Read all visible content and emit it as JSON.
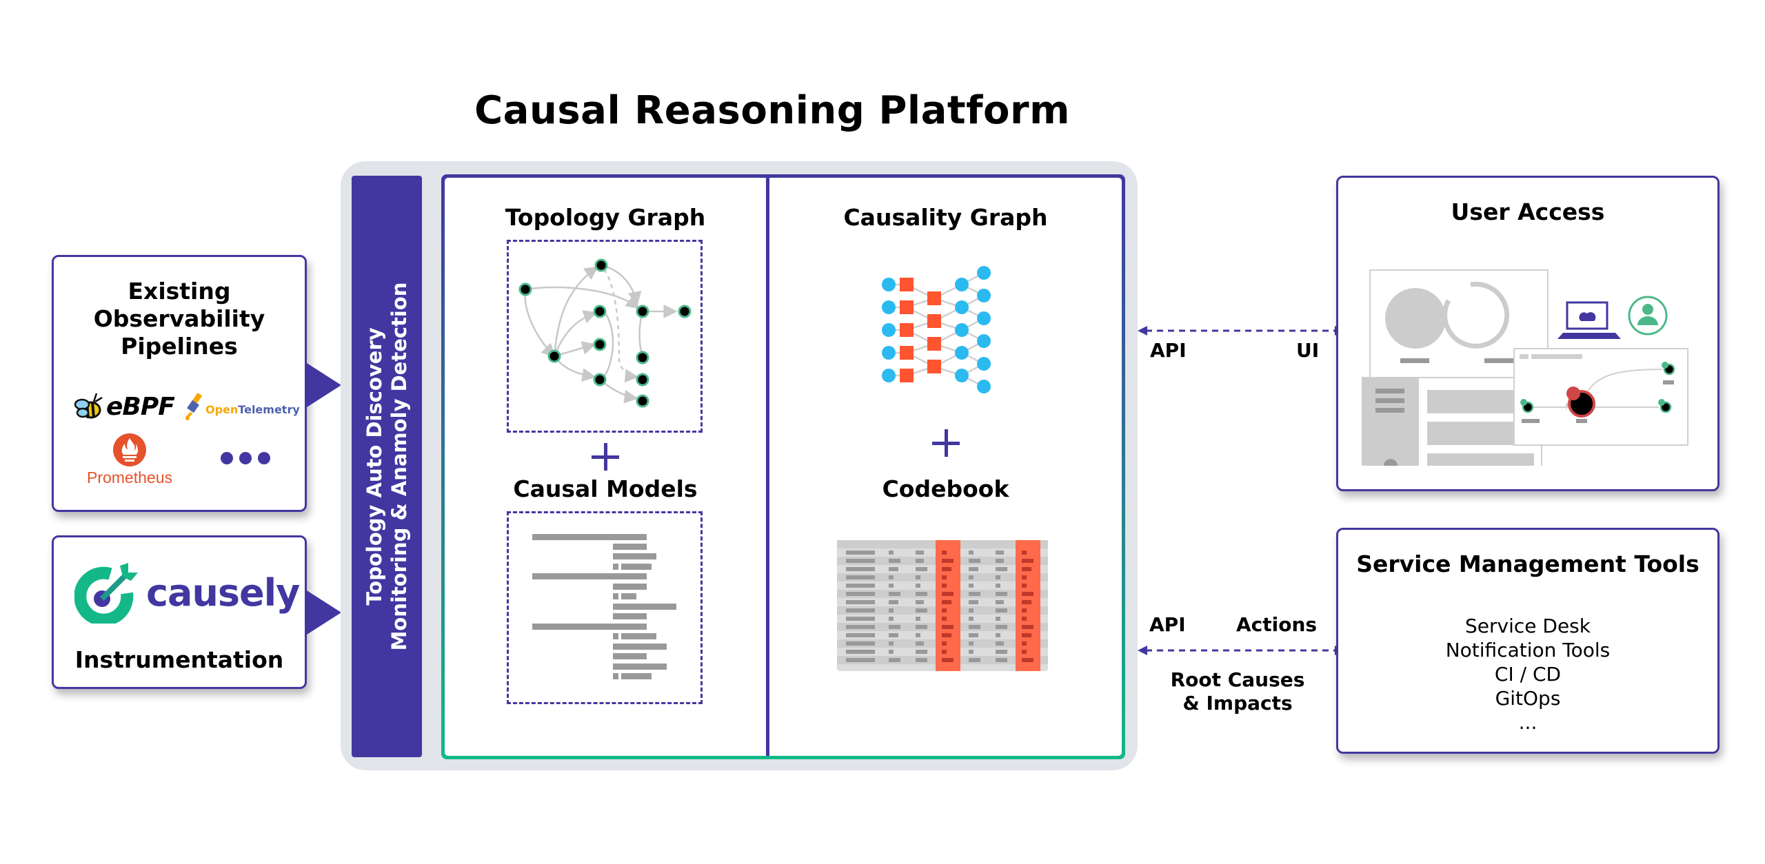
{
  "title": "Causal Reasoning Platform",
  "colors": {
    "primary": "#4237a0",
    "accent_green": "#14b888",
    "node_blue": "#2bbaf0",
    "node_orange": "#fe5530",
    "platform_bg": "#e1e5ea",
    "gray": "#999999"
  },
  "left": {
    "observability": {
      "title_lines": [
        "Existing",
        "Observability",
        "Pipelines"
      ],
      "logos": [
        {
          "name": "eBPF",
          "icon": "bee-icon"
        },
        {
          "name": "OpenTelemetry",
          "icon": "telescope-icon"
        },
        {
          "name": "Prometheus",
          "icon": "flame-icon"
        },
        {
          "name": "more",
          "icon": "ellipsis-icon"
        }
      ],
      "ebpf_label": "eBPF",
      "otel_label_open": "Open",
      "otel_label_rest": "Telemetry",
      "prometheus_label": "Prometheus"
    },
    "instrumentation": {
      "brand": "causely",
      "title": "Instrumentation"
    }
  },
  "platform": {
    "sidebar_line1": "Topology Auto Discovery",
    "sidebar_line2": "Monitoring & Anamoly Detection",
    "left_column": {
      "top_title": "Topology Graph",
      "bottom_title": "Causal Models"
    },
    "right_column": {
      "top_title": "Causality Graph",
      "bottom_title": "Codebook"
    }
  },
  "connectors": {
    "top": {
      "left_label": "API",
      "right_label": "UI"
    },
    "bottom": {
      "left_label": "API",
      "right_label": "Actions",
      "below_line1": "Root Causes",
      "below_line2": "& Impacts"
    }
  },
  "right": {
    "user_access": {
      "title": "User Access"
    },
    "service_tools": {
      "title": "Service Management Tools",
      "items": [
        "Service Desk",
        "Notification Tools",
        "CI / CD",
        "GitOps",
        "..."
      ]
    }
  }
}
